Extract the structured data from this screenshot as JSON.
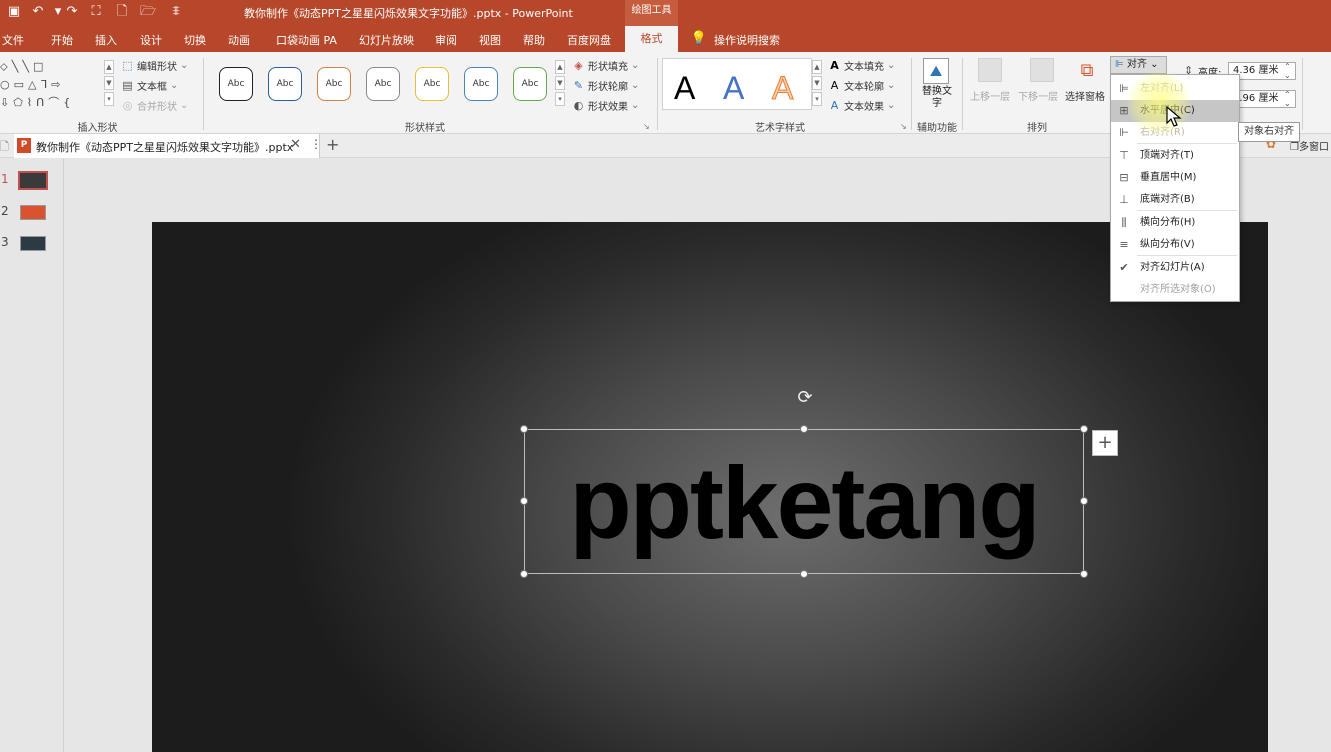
{
  "titlebar": {
    "doc_title": "教你制作《动态PPT之星星闪烁效果文字功能》.pptx  -  PowerPoint",
    "context_tab": "绘图工具",
    "quick_access": [
      {
        "icon": "save-icon",
        "glyph": "▣"
      },
      {
        "icon": "undo-icon",
        "glyph": "↶"
      },
      {
        "icon": "dropdown-icon",
        "glyph": "▾"
      },
      {
        "icon": "redo-icon",
        "glyph": "↷"
      },
      {
        "icon": "present-icon",
        "glyph": "⛶"
      },
      {
        "icon": "new-file-icon",
        "glyph": "🗋"
      },
      {
        "icon": "open-folder-icon",
        "glyph": "🗁"
      },
      {
        "icon": "customize-icon",
        "glyph": "⩨"
      }
    ]
  },
  "tabs": [
    "文件",
    "开始",
    "插入",
    "设计",
    "切换",
    "动画",
    "口袋动画 PA",
    "幻灯片放映",
    "审阅",
    "视图",
    "帮助",
    "百度网盘"
  ],
  "active_tab": "格式",
  "tell_me": "操作说明搜索",
  "ribbon": {
    "insert_shapes": {
      "label": "插入形状",
      "shape_glyphs_row1": "⬦╲╲□",
      "shape_glyphs_row2": "○▭△ᒣ⇨",
      "shape_glyphs_row3": "⇩⬠⌇ᑎ⌒{",
      "edit_shape": "编辑形状",
      "text_box": "文本框",
      "merge_shapes": "合并形状"
    },
    "shape_styles": {
      "label": "形状样式",
      "swatch_text": "Abc",
      "swatch_colors": [
        "#222222",
        "#2e5f8f",
        "#d08040",
        "#8a8a8a",
        "#e0c040",
        "#4a86b8",
        "#6aa84f"
      ],
      "fill": "形状填充",
      "outline": "形状轮廓",
      "effects": "形状效果"
    },
    "wordart": {
      "label": "艺术字样式",
      "letter": "A",
      "colors": [
        "#000000",
        "#4472c4",
        "#ed7d31"
      ],
      "text_fill": "文本填充",
      "text_outline": "文本轮廓",
      "text_effects": "文本效果"
    },
    "accessibility": {
      "label": "辅助功能",
      "alt_text": "替换文字"
    },
    "arrange": {
      "label": "排列",
      "bring_forward": "上移一层",
      "send_backward": "下移一层",
      "selection_pane": "选择窗格",
      "align": "对齐"
    },
    "size": {
      "height_label": "高度:",
      "height_value": "4.36 厘米",
      "width_value": "5.96 厘米"
    }
  },
  "document_tab": {
    "name": "教你制作《动态PPT之星星闪烁效果文字功能》.pptx",
    "add": "+"
  },
  "right_strip": {
    "multi_window": "多窗口"
  },
  "thumbnails": [
    {
      "num": "1",
      "color": "#3a3a3a"
    },
    {
      "num": "2",
      "color": "#d9542e"
    },
    {
      "num": "3",
      "color": "#2c3a44"
    }
  ],
  "slide": {
    "text": "pptketang",
    "plus": "+"
  },
  "align_menu": [
    {
      "label": "左对齐(L)",
      "icon": "align-left-icon",
      "glyph": "⊫",
      "state": "dim"
    },
    {
      "label": "水平居中(C)",
      "icon": "align-center-icon",
      "glyph": "⊞",
      "state": "hover"
    },
    {
      "label": "右对齐(R)",
      "icon": "align-right-icon",
      "glyph": "⊩",
      "state": "dim"
    },
    {
      "label": "顶端对齐(T)",
      "icon": "align-top-icon",
      "glyph": "⊤",
      "state": "normal"
    },
    {
      "label": "垂直居中(M)",
      "icon": "align-middle-icon",
      "glyph": "⊟",
      "state": "normal"
    },
    {
      "label": "底端对齐(B)",
      "icon": "align-bottom-icon",
      "glyph": "⊥",
      "state": "normal"
    },
    {
      "label": "横向分布(H)",
      "icon": "distribute-horizontal-icon",
      "glyph": "⫼",
      "state": "normal"
    },
    {
      "label": "纵向分布(V)",
      "icon": "distribute-vertical-icon",
      "glyph": "≡",
      "state": "normal"
    },
    {
      "label": "对齐幻灯片(A)",
      "icon": "check-icon",
      "glyph": "✔",
      "state": "checked"
    },
    {
      "label": "对齐所选对象(O)",
      "icon": "",
      "glyph": "",
      "state": "disabled"
    }
  ],
  "tooltip": "对象右对齐"
}
